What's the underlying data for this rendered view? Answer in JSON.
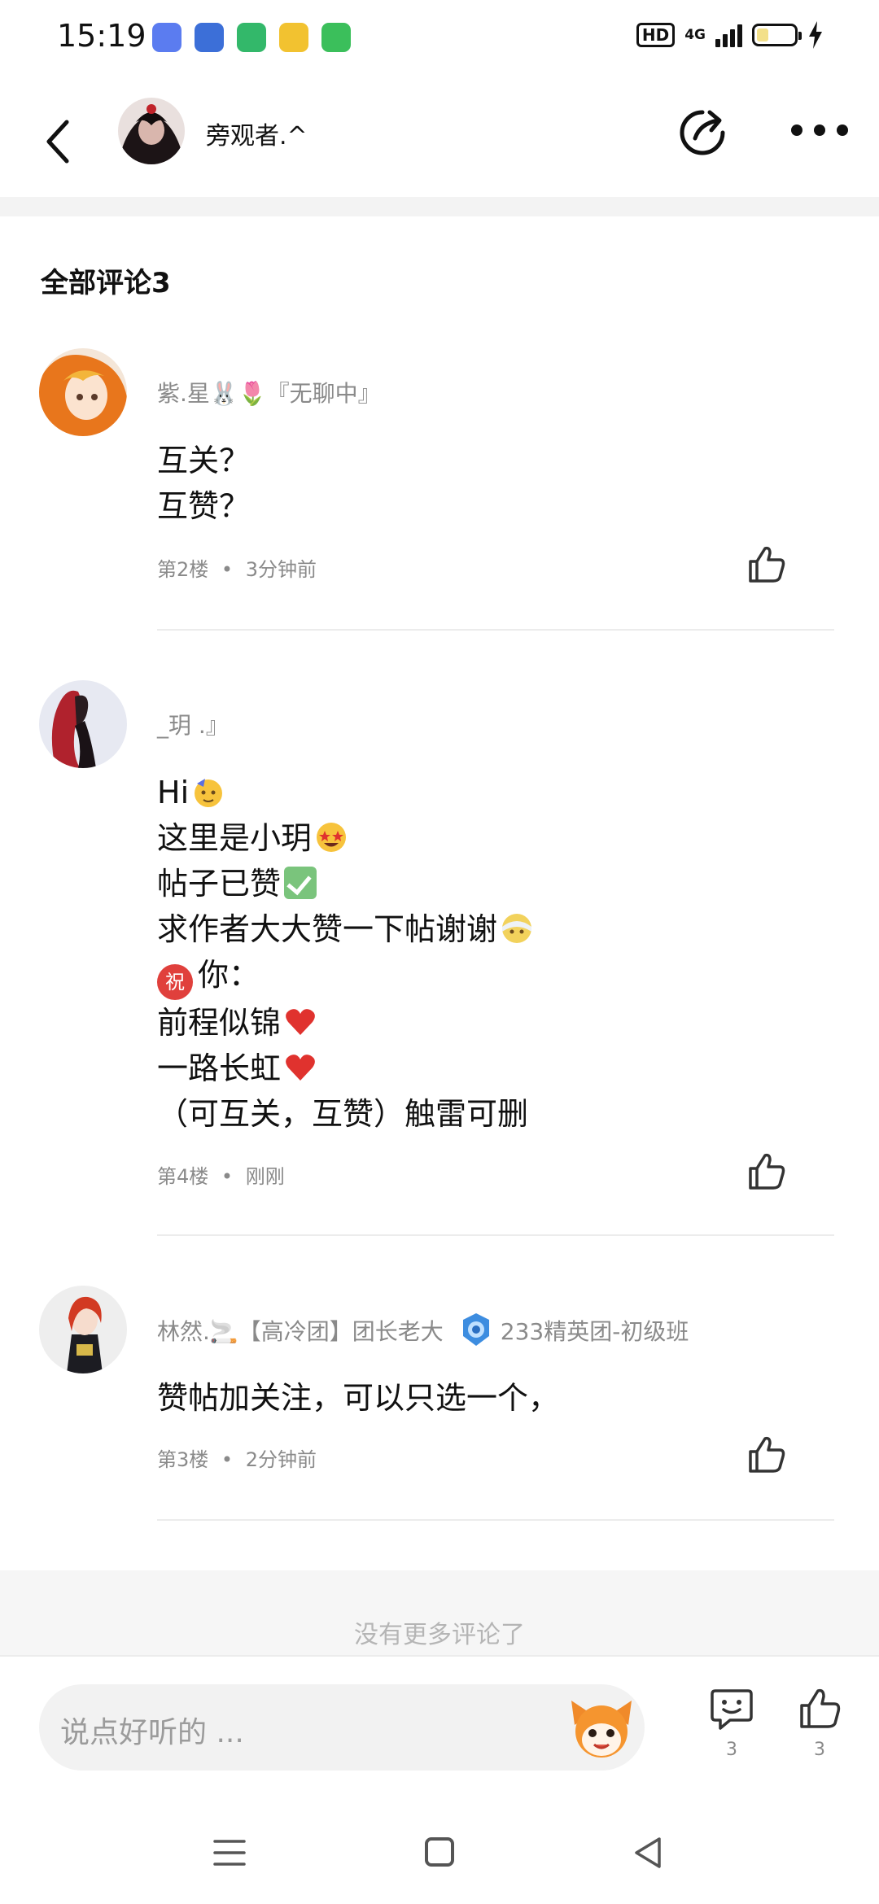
{
  "status_bar": {
    "time": "15:19",
    "net_label": "4G",
    "hd_label": "HD",
    "app_icon_colors": [
      "#5b7cf0",
      "#3c6fd8",
      "#33b86a",
      "#f2c230",
      "#3bbf5b"
    ]
  },
  "header": {
    "back_icon": "chevron-left-icon",
    "username": "旁观者.^",
    "share_icon": "share-icon",
    "more_icon": "more-icon"
  },
  "comments_section": {
    "title": "全部评论3",
    "comments": [
      {
        "name": "紫.星🐰🌷『无聊中』",
        "lines": [
          "互关？",
          "互赞？"
        ],
        "floor": "第2楼",
        "time": "3分钟前"
      },
      {
        "name": "_玥 .』",
        "lines": [
          "Hi",
          "这里是小玥",
          "帖子已赞",
          "求作者大大赞一下帖谢谢",
          "祝",
          "你：",
          "前程似锦",
          "一路长虹",
          "（可互关，互赞）触雷可删"
        ],
        "floor": "第4楼",
        "time": "刚刚"
      },
      {
        "name": "林然.🚬【高冷团】团长老大",
        "group": "233精英团-初级班",
        "lines": [
          "赞帖加关注，可以只选一个，"
        ],
        "floor": "第3楼",
        "time": "2分钟前"
      }
    ],
    "meta_separator": "•",
    "no_more": "没有更多评论了"
  },
  "bottom_bar": {
    "input_placeholder": "说点好听的 ...",
    "comment_count": "3",
    "like_count": "3"
  },
  "colors": {
    "text_primary": "#111111",
    "text_secondary": "#8a8a8a",
    "divider": "#ececec",
    "heart": "#e0322e",
    "check": "#7ac47c"
  }
}
